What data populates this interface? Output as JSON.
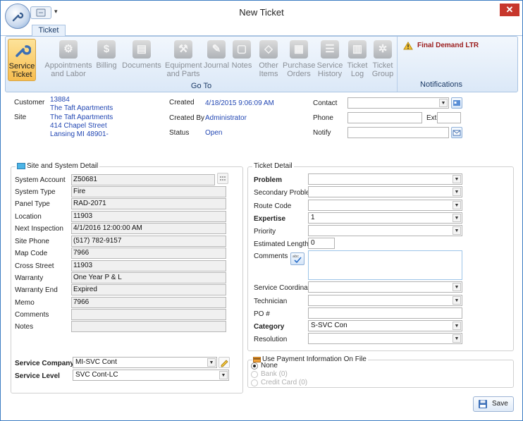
{
  "window": {
    "title": "New Ticket",
    "close_glyph": "✕",
    "tab": "Ticket"
  },
  "ribbon": {
    "buttons": [
      {
        "label": "Service\nTicket",
        "icon": "wrench-icon"
      },
      {
        "label": "Appointments\nand Labor",
        "icon": "gear-icon"
      },
      {
        "label": "Billing",
        "icon": "dollar-icon"
      },
      {
        "label": "Documents",
        "icon": "document-icon"
      },
      {
        "label": "Equipment\nand Parts",
        "icon": "equipment-icon"
      },
      {
        "label": "Journal",
        "icon": "journal-icon"
      },
      {
        "label": "Notes",
        "icon": "notes-icon"
      },
      {
        "label": "Other\nItems",
        "icon": "tag-icon"
      },
      {
        "label": "Purchase\nOrders",
        "icon": "purchase-order-icon"
      },
      {
        "label": "Service\nHistory",
        "icon": "history-icon"
      },
      {
        "label": "Ticket\nLog",
        "icon": "ticket-log-icon"
      },
      {
        "label": "Ticket\nGroup",
        "icon": "ticket-group-icon"
      }
    ],
    "group_label": "Go To",
    "notification": "Final Demand LTR",
    "notifications_label": "Notifications"
  },
  "header": {
    "customer_label": "Customer",
    "customer_id": "13884",
    "customer_name": "The Taft Apartments",
    "site_label": "Site",
    "site_name": "The Taft Apartments",
    "site_street": "414 Chapel Street",
    "site_city": "Lansing MI 48901-",
    "created_label": "Created",
    "created_value": "4/18/2015 9:06:09 AM",
    "created_by_label": "Created By",
    "created_by_value": "Administrator",
    "status_label": "Status",
    "status_value": "Open",
    "contact_label": "Contact",
    "phone_label": "Phone",
    "ext_label": "Ext",
    "notify_label": "Notify"
  },
  "site_detail": {
    "title": "Site and System Detail",
    "rows": [
      {
        "label": "System Account",
        "value": "Z50681"
      },
      {
        "label": "System Type",
        "value": "Fire"
      },
      {
        "label": "Panel Type",
        "value": "RAD-2071"
      },
      {
        "label": "Location",
        "value": "11903"
      },
      {
        "label": "Next Inspection",
        "value": "4/1/2016 12:00:00 AM"
      },
      {
        "label": "Site Phone",
        "value": "(517) 782-9157"
      },
      {
        "label": "Map Code",
        "value": "7966"
      },
      {
        "label": "Cross Street",
        "value": "11903"
      },
      {
        "label": "Warranty",
        "value": "One Year P & L"
      },
      {
        "label": "Warranty End",
        "value": "Expired"
      },
      {
        "label": "Memo",
        "value": "7966"
      },
      {
        "label": "Comments",
        "value": ""
      },
      {
        "label": "Notes",
        "value": ""
      }
    ],
    "service_company_label": "Service Company",
    "service_company_value": "MI-SVC Cont",
    "service_level_label": "Service Level",
    "service_level_value": "SVC Cont-LC"
  },
  "ticket_detail": {
    "title": "Ticket Detail",
    "problem_label": "Problem",
    "secondary_problem_label": "Secondary Problem",
    "route_code_label": "Route Code",
    "expertise_label": "Expertise",
    "expertise_value": "1",
    "priority_label": "Priority",
    "estimated_length_label": "Estimated Length",
    "estimated_length_value": "0",
    "comments_label": "Comments",
    "service_coordinator_label": "Service Coordinator",
    "technician_label": "Technician",
    "po_label": "PO #",
    "category_label": "Category",
    "category_value": "S-SVC Con",
    "resolution_label": "Resolution"
  },
  "payment": {
    "title": "Use Payment Information On File",
    "options": [
      "None",
      "Bank (0)",
      "Credit Card (0)"
    ]
  },
  "save_label": "Save",
  "colors": {
    "accent": "#2247b3",
    "ribbon_active": "#f7bd4f",
    "close": "#c7372c"
  }
}
